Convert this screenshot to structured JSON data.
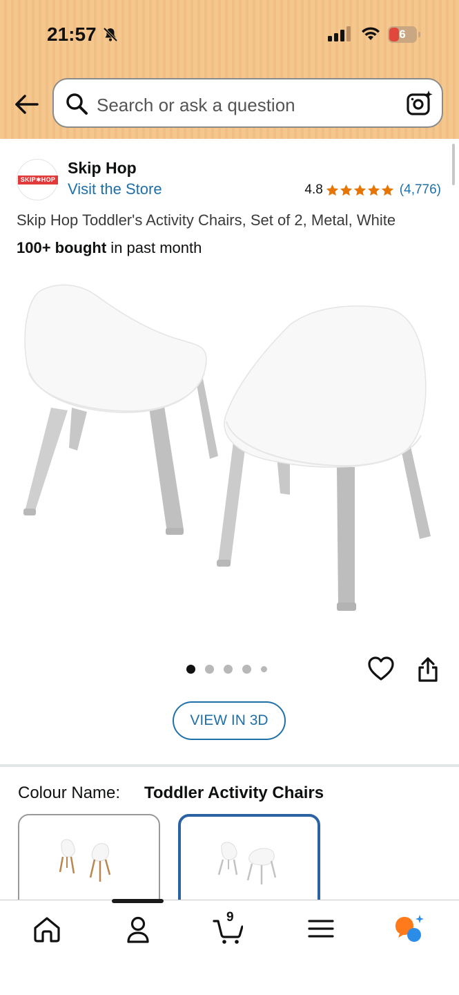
{
  "status_bar": {
    "time": "21:57",
    "battery_level": "6"
  },
  "header": {
    "search_placeholder": "Search or ask a question"
  },
  "brand": {
    "logo_text": "SKIP✱HOP",
    "name": "Skip Hop",
    "store_link": "Visit the Store"
  },
  "rating": {
    "value": "4.8",
    "stars": 5,
    "count": "(4,776)"
  },
  "product": {
    "title": "Skip Hop Toddler's Activity Chairs, Set of 2, Metal, White",
    "bought_bold": "100+ bought",
    "bought_rest": " in past month",
    "image_count": 5,
    "active_image_index": 0
  },
  "actions": {
    "view_3d": "VIEW IN 3D"
  },
  "colour": {
    "label": "Colour Name:",
    "value": "Toddler Activity Chairs",
    "selected_swatch_index": 1
  },
  "bottom_nav": {
    "cart_count": "9",
    "items": [
      "home-icon",
      "profile-icon",
      "cart-icon",
      "menu-icon",
      "ai-assistant-icon"
    ]
  },
  "colors": {
    "header_bg": "#f4c78f",
    "link": "#1f6fa8",
    "star": "#e77600",
    "selected_border": "#2a62a3",
    "ai_orange": "#ff7a1a",
    "ai_blue": "#2b8de8"
  }
}
